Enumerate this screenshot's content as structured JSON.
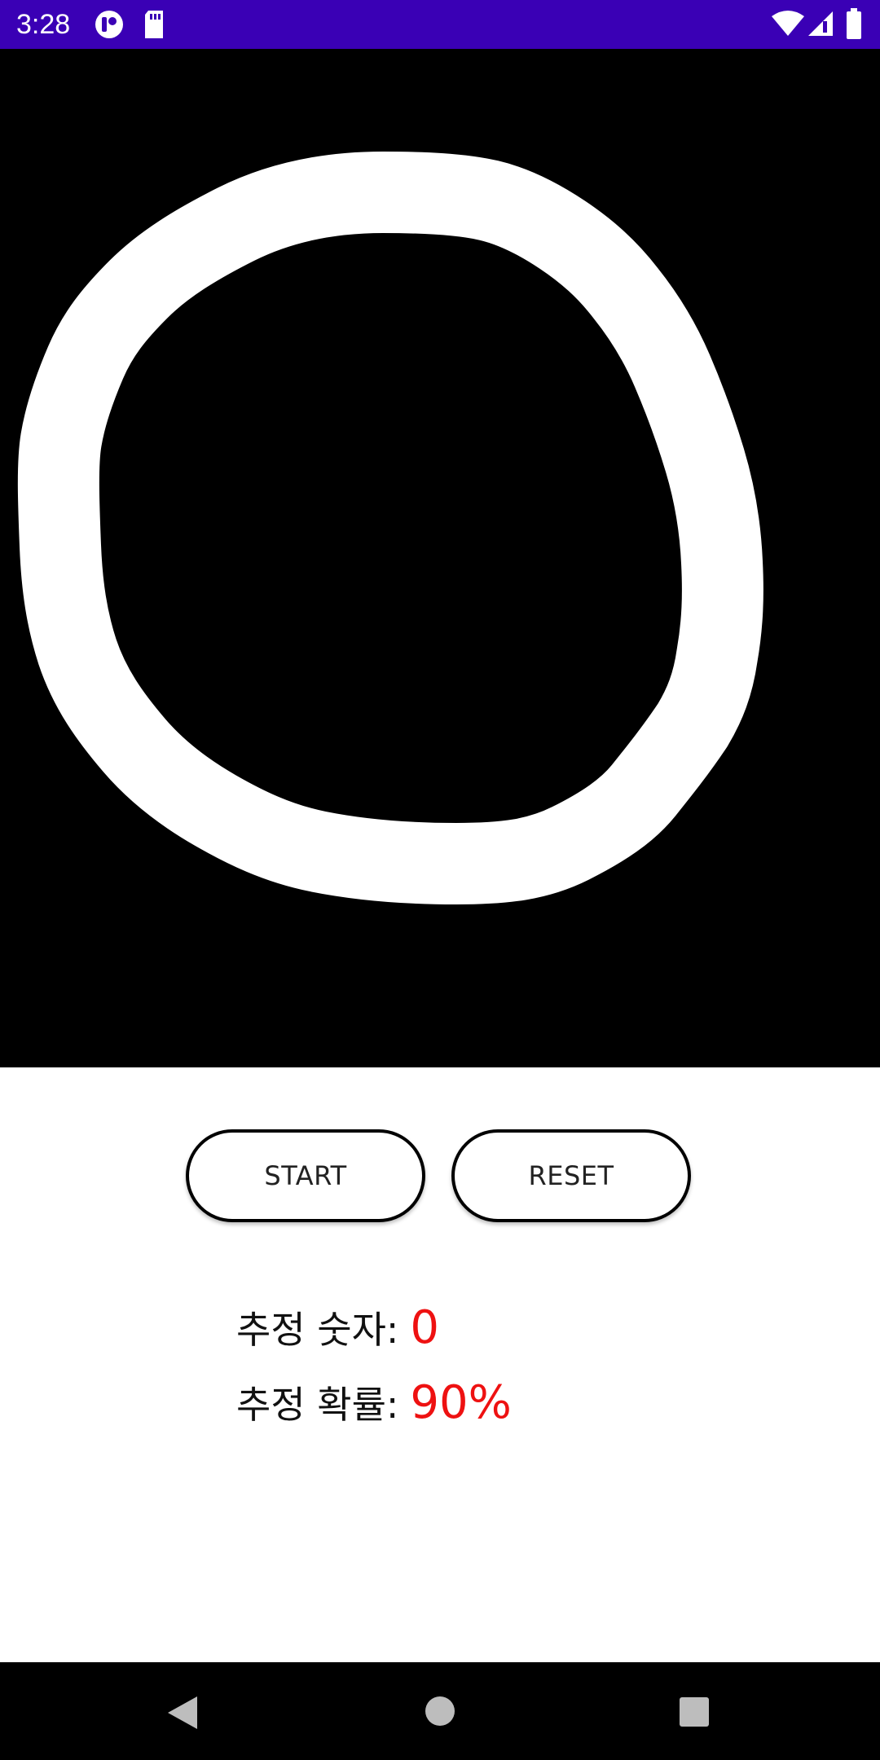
{
  "status_bar": {
    "time": "3:28",
    "bg_color": "#3a00b5",
    "left_icons": [
      "app-notification-icon",
      "sd-card-icon"
    ],
    "right_icons": [
      "wifi-icon",
      "cell-signal-icon",
      "battery-icon"
    ]
  },
  "canvas": {
    "bg_color": "#000000",
    "stroke_color": "#ffffff"
  },
  "buttons": {
    "start_label": "START",
    "reset_label": "RESET"
  },
  "result": {
    "digit_label": "추정 숫자:",
    "digit_value": "0",
    "prob_label": "추정 확률:",
    "prob_value": "90%",
    "value_color": "#ee1111"
  },
  "nav_bar": {
    "icons": [
      "back-icon",
      "home-icon",
      "recents-icon"
    ]
  }
}
